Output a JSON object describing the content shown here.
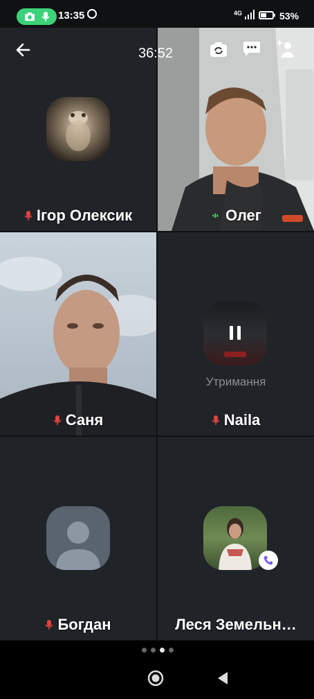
{
  "status_bar": {
    "time": "13:35",
    "network": "4G",
    "battery": "53%",
    "battery_level": 0.53
  },
  "call": {
    "timer": "36:52",
    "participants": [
      {
        "name": "Ігор Олексик",
        "mic": "muted"
      },
      {
        "name": "Олег",
        "mic": "active"
      },
      {
        "name": "Саня",
        "mic": "muted"
      },
      {
        "name": "Naila",
        "mic": "muted",
        "status": "Утримання"
      },
      {
        "name": "Богдан",
        "mic": "muted"
      },
      {
        "name": "Леся Земельн…",
        "mic": "none"
      }
    ]
  },
  "pager": {
    "page_count": 4,
    "active_page": 3
  },
  "colors": {
    "muted_mic": "#e0433f",
    "active_mic": "#4cd964",
    "viber": "#7360f2",
    "pill": "#3dd27a"
  }
}
